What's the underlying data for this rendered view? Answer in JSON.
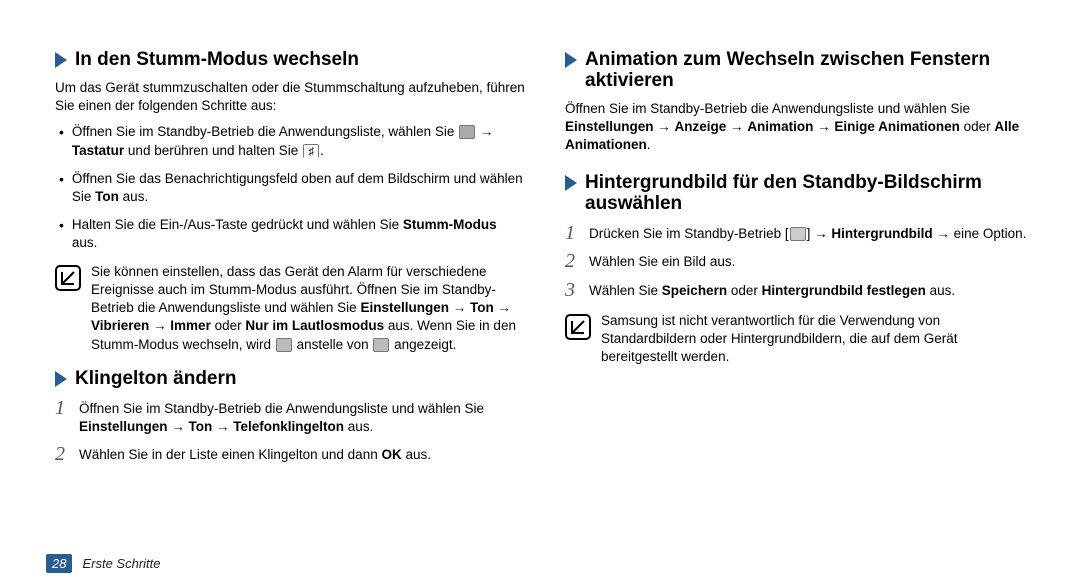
{
  "left": {
    "sec1": {
      "title": "In den Stumm-Modus wechseln",
      "intro": "Um das Gerät stummzuschalten oder die Stummschaltung aufzuheben, führen Sie einen der folgenden Schritte aus:",
      "b1_a": "Öffnen Sie im Standby-Betrieb die Anwendungsliste, wählen Sie ",
      "b1_b": " → ",
      "b1_c": "Tastatur",
      "b1_d": " und berühren und halten Sie ",
      "b1_e": ".",
      "b2_a": "Öffnen Sie das Benachrichtigungsfeld oben auf dem Bildschirm und wählen Sie ",
      "b2_b": "Ton",
      "b2_c": " aus.",
      "b3_a": "Halten Sie die Ein-/Aus-Taste gedrückt und wählen Sie ",
      "b3_b": "Stumm-Modus",
      "b3_c": " aus.",
      "note_a": "Sie können einstellen, dass das Gerät den Alarm für verschiedene Ereignisse auch im Stumm-Modus ausführt. Öffnen Sie im Standby-Betrieb die Anwendungsliste und wählen Sie ",
      "note_b": "Einstellungen",
      "note_c": " → ",
      "note_d": "Ton",
      "note_e": " → ",
      "note_f": "Vibrieren",
      "note_g": " → ",
      "note_h": "Immer",
      "note_i": " oder ",
      "note_j": "Nur im Lautlosmodus",
      "note_k": " aus. Wenn Sie in den Stumm-Modus wechseln, wird ",
      "note_l": " anstelle von ",
      "note_m": " angezeigt."
    },
    "sec2": {
      "title": "Klingelton ändern",
      "s1_a": "Öffnen Sie im Standby-Betrieb die Anwendungsliste und wählen Sie ",
      "s1_b": "Einstellungen",
      "s1_c": " → ",
      "s1_d": "Ton",
      "s1_e": " → ",
      "s1_f": "Telefonklingelton",
      "s1_g": " aus.",
      "s2_a": "Wählen Sie in der Liste einen Klingelton und dann ",
      "s2_b": "OK",
      "s2_c": " aus."
    }
  },
  "right": {
    "sec3": {
      "title": "Animation zum Wechseln zwischen Fenstern aktivieren",
      "p_a": "Öffnen Sie im Standby-Betrieb die Anwendungsliste und wählen Sie ",
      "p_b": "Einstellungen",
      "p_c": " → ",
      "p_d": "Anzeige",
      "p_e": " → ",
      "p_f": "Animation",
      "p_g": " → ",
      "p_h": "Einige Animationen",
      "p_i": " oder ",
      "p_j": "Alle Animationen",
      "p_k": "."
    },
    "sec4": {
      "title": "Hintergrundbild für den Standby-Bildschirm auswählen",
      "s1_a": "Drücken Sie im Standby-Betrieb [",
      "s1_b": "] → ",
      "s1_c": "Hintergrundbild",
      "s1_d": " → eine Option.",
      "s2": "Wählen Sie ein Bild aus.",
      "s3_a": "Wählen Sie ",
      "s3_b": "Speichern",
      "s3_c": " oder ",
      "s3_d": "Hintergrundbild festlegen",
      "s3_e": " aus.",
      "note": "Samsung ist nicht verantwortlich für die Verwendung von Standardbildern oder Hintergrundbildern, die auf dem Gerät bereitgestellt werden."
    }
  },
  "footer": {
    "page": "28",
    "trail": "Erste Schritte"
  },
  "nums": {
    "n1": "1",
    "n2": "2",
    "n3": "3"
  }
}
